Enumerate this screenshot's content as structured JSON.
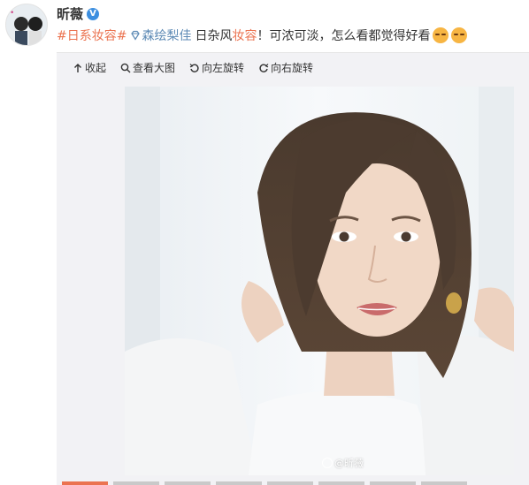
{
  "user": {
    "name": "昕薇",
    "verified_badge": "V"
  },
  "post": {
    "topic": "#日系妆容#",
    "super_topic": "森绘梨佳",
    "text_part1": "日杂风",
    "text_highlight": "妆容",
    "text_part2": "！可浓可淡，怎么看都觉得好看"
  },
  "toolbar": {
    "collapse_label": "收起",
    "view_large_label": "查看大图",
    "rotate_left_label": "向左旋转",
    "rotate_right_label": "向右旋转"
  },
  "image": {
    "watermark_text": "@昕薇"
  },
  "colors": {
    "accent": "#eb7350",
    "link": "#5d8ab5",
    "badge": "#3d8fe0"
  },
  "icons": [
    "avatar",
    "verified-badge-icon",
    "diamond-icon",
    "emoji-icon",
    "collapse-icon",
    "search-icon",
    "rotate-left-icon",
    "rotate-right-icon",
    "weibo-logo-icon"
  ]
}
